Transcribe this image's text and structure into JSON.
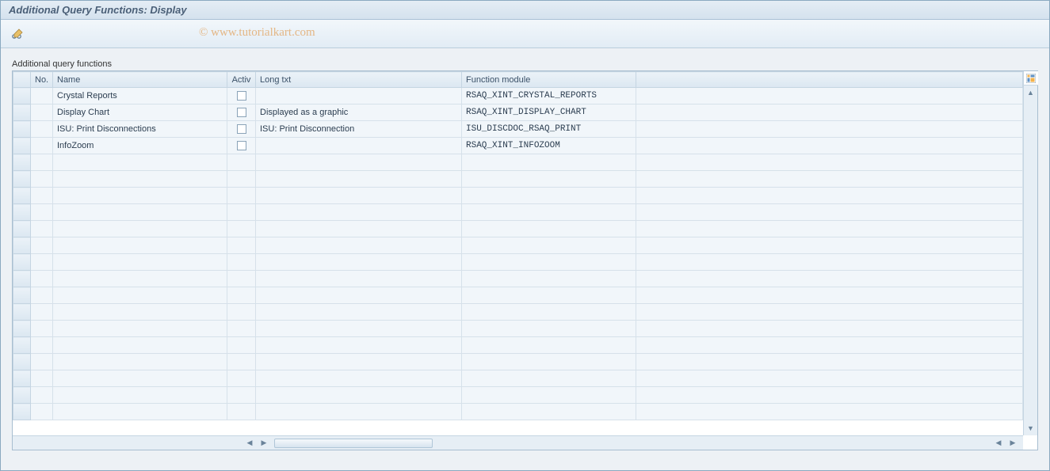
{
  "window": {
    "title": "Additional Query Functions: Display"
  },
  "watermark": "© www.tutorialkart.com",
  "section": {
    "label": "Additional query functions"
  },
  "table": {
    "columns": {
      "sel": "",
      "no": "No.",
      "name": "Name",
      "activ": "Activ",
      "long": "Long txt",
      "func": "Function module"
    },
    "rows": [
      {
        "no": "",
        "name": "Crystal Reports",
        "activ": false,
        "long": "",
        "func": "RSAQ_XINT_CRYSTAL_REPORTS"
      },
      {
        "no": "",
        "name": "Display Chart",
        "activ": false,
        "long": "Displayed as a graphic",
        "func": "RSAQ_XINT_DISPLAY_CHART"
      },
      {
        "no": "",
        "name": "ISU: Print Disconnections",
        "activ": false,
        "long": "ISU: Print Disconnection",
        "func": "ISU_DISCDOC_RSAQ_PRINT"
      },
      {
        "no": "",
        "name": "InfoZoom",
        "activ": false,
        "long": "",
        "func": "RSAQ_XINT_INFOZOOM"
      }
    ],
    "empty_rows": 16
  }
}
